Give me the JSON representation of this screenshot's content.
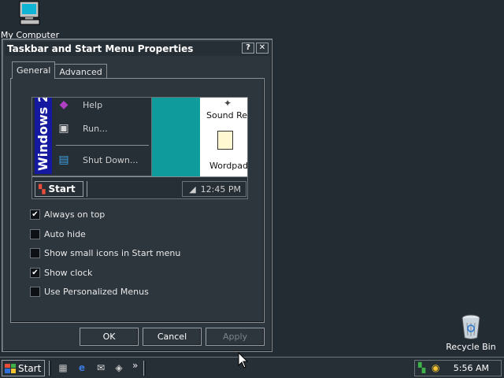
{
  "desktop": {
    "icons": [
      {
        "label": "My Computer"
      },
      {
        "label": "Recycle Bin"
      }
    ]
  },
  "dialog": {
    "title": "Taskbar and Start Menu Properties",
    "help_glyph": "?",
    "close_glyph": "✕",
    "tabs": [
      {
        "label": "General",
        "active": true
      },
      {
        "label": "Advanced",
        "active": false
      }
    ],
    "preview": {
      "banner_text": "Windows 2",
      "menu_items": [
        "Help",
        "Run...",
        "Shut Down..."
      ],
      "desktop_items": [
        "Sound Re",
        "Wordpad"
      ],
      "start_label": "Start",
      "clock": "12:45 PM"
    },
    "options": [
      {
        "label": "Always on top",
        "checked": true
      },
      {
        "label": "Auto hide",
        "checked": false
      },
      {
        "label": "Show small icons in Start menu",
        "checked": false
      },
      {
        "label": "Show clock",
        "checked": true
      },
      {
        "label": "Use Personalized Menus",
        "checked": false
      }
    ],
    "buttons": {
      "ok": "OK",
      "cancel": "Cancel",
      "apply": "Apply"
    }
  },
  "taskbar": {
    "start_label": "Start",
    "quick_launch": [
      "show-desktop-icon",
      "internet-explorer-icon",
      "outlook-express-icon",
      "channels-icon"
    ],
    "chevron": "»",
    "clock": "5:56 AM"
  }
}
